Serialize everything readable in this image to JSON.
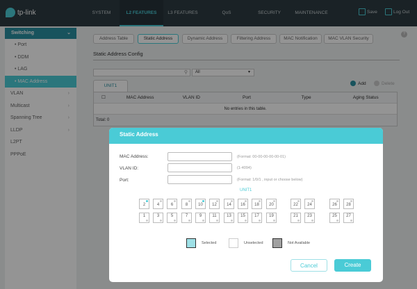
{
  "header": {
    "brand": "tp-link",
    "nav": [
      "SYSTEM",
      "L2 FEATURES",
      "L3 FEATURES",
      "QoS",
      "SECURITY",
      "MAINTENANCE"
    ],
    "active_nav": "L2 FEATURES",
    "save": "Save",
    "logout": "Log Out"
  },
  "sidebar": {
    "section": "Switching",
    "sub_items": [
      "Port",
      "DDM",
      "LAG",
      "MAC Address"
    ],
    "selected": "MAC Address",
    "items": [
      "VLAN",
      "Multicast",
      "Spanning Tree",
      "LLDP",
      "L2PT",
      "PPPoE"
    ]
  },
  "main": {
    "tabs": [
      "Address Table",
      "Static Address",
      "Dynamic Address",
      "Filtering Address",
      "MAC Notification",
      "MAC VLAN Security"
    ],
    "active_tab": "Static Address",
    "help": "?",
    "section_title": "Static Address Config",
    "search_placeholder": "",
    "filter_value": "All",
    "unit_tab": "UNIT1",
    "add": "Add",
    "delete": "Delete",
    "table": {
      "columns": [
        "MAC Address",
        "VLAN ID",
        "Port",
        "Type",
        "Aging Status"
      ],
      "empty": "No entries in this table.",
      "total": "Total: 0"
    }
  },
  "modal": {
    "title": "Static Address",
    "fields": [
      {
        "label": "MAC Address:",
        "value": "",
        "hint": "(Format: 00-00-00-00-00-01)"
      },
      {
        "label": "VLAN ID:",
        "value": "",
        "hint": "(1-4094)"
      },
      {
        "label": "Port:",
        "value": "",
        "hint": "(Format: 1/0/1 , input or choose below)"
      }
    ],
    "unit": "UNIT1",
    "top_ports": [
      "2",
      "4",
      "6",
      "8",
      "10",
      "12",
      "14",
      "16",
      "18",
      "20",
      "22",
      "24",
      "26",
      "28"
    ],
    "bottom_ports": [
      "1",
      "3",
      "5",
      "7",
      "9",
      "11",
      "13",
      "15",
      "17",
      "19",
      "21",
      "23",
      "25",
      "27"
    ],
    "link_up_ports": [
      "2",
      "10"
    ],
    "legend": {
      "selected": "Selected",
      "unselected": "Unselected",
      "not_available": "Not Available"
    },
    "cancel": "Cancel",
    "create": "Create"
  },
  "colors": {
    "accent": "#4acbd6",
    "topbar": "#2e3b42",
    "selected_port": "#9ee0e6",
    "not_available_port": "#a0a0a0"
  }
}
